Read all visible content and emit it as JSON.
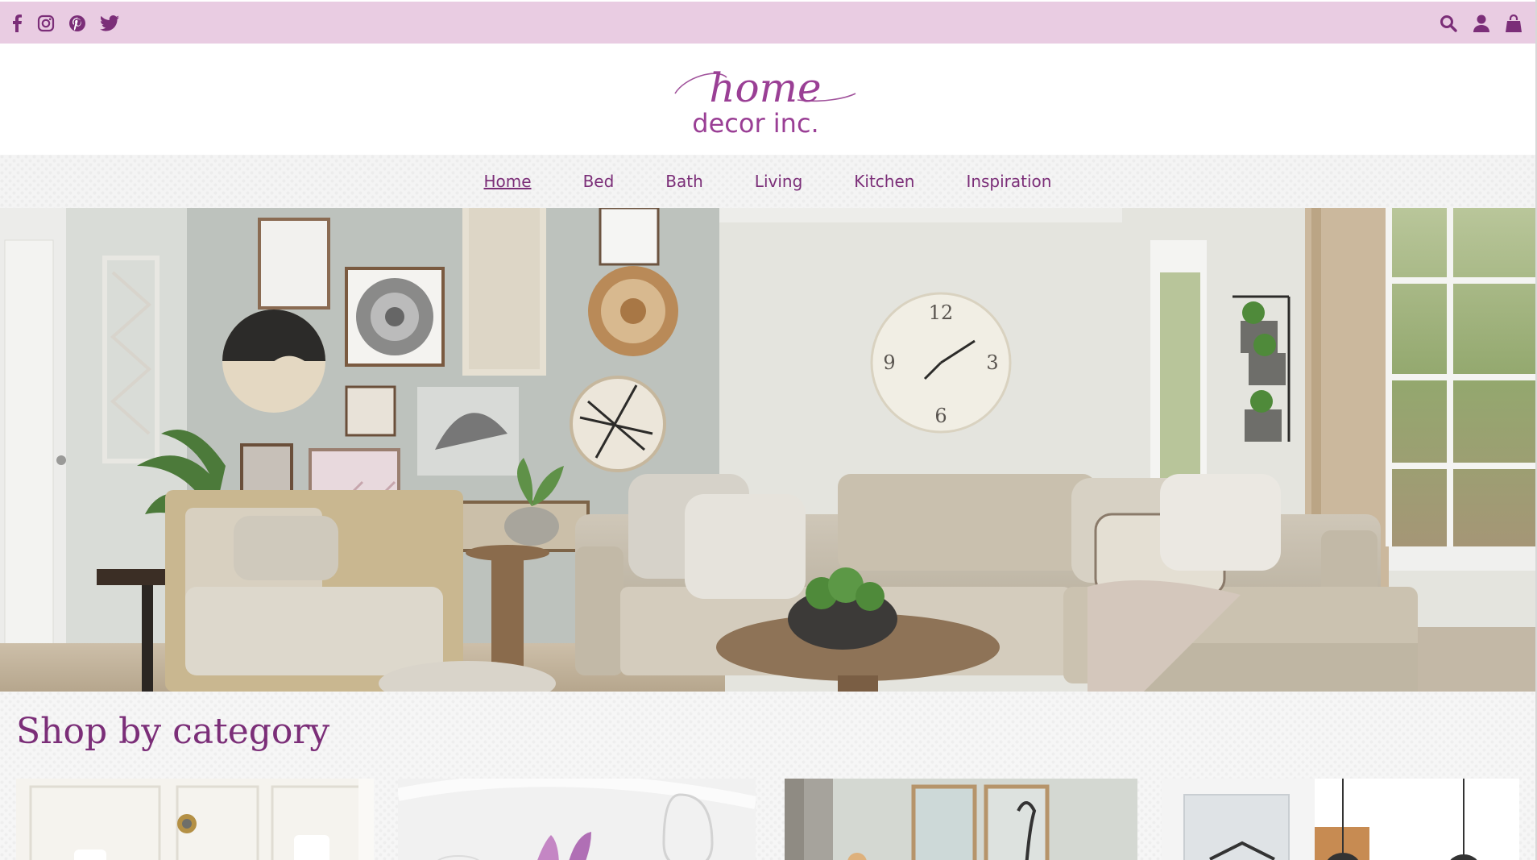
{
  "social": [
    {
      "name": "facebook-icon",
      "label": "Facebook"
    },
    {
      "name": "instagram-icon",
      "label": "Instagram"
    },
    {
      "name": "pinterest-icon",
      "label": "Pinterest"
    },
    {
      "name": "twitter-icon",
      "label": "Twitter"
    }
  ],
  "utility": [
    {
      "name": "search-icon",
      "label": "Search"
    },
    {
      "name": "account-icon",
      "label": "Account"
    },
    {
      "name": "cart-icon",
      "label": "Cart"
    }
  ],
  "logo": {
    "top": "home",
    "bottom": "decor inc."
  },
  "nav": {
    "items": [
      {
        "label": "Home",
        "active": true
      },
      {
        "label": "Bed"
      },
      {
        "label": "Bath"
      },
      {
        "label": "Living"
      },
      {
        "label": "Kitchen"
      },
      {
        "label": "Inspiration"
      }
    ]
  },
  "category": {
    "title": "Shop by category"
  },
  "colors": {
    "brand": "#7b2e78",
    "topbar": "#e9cce2"
  }
}
